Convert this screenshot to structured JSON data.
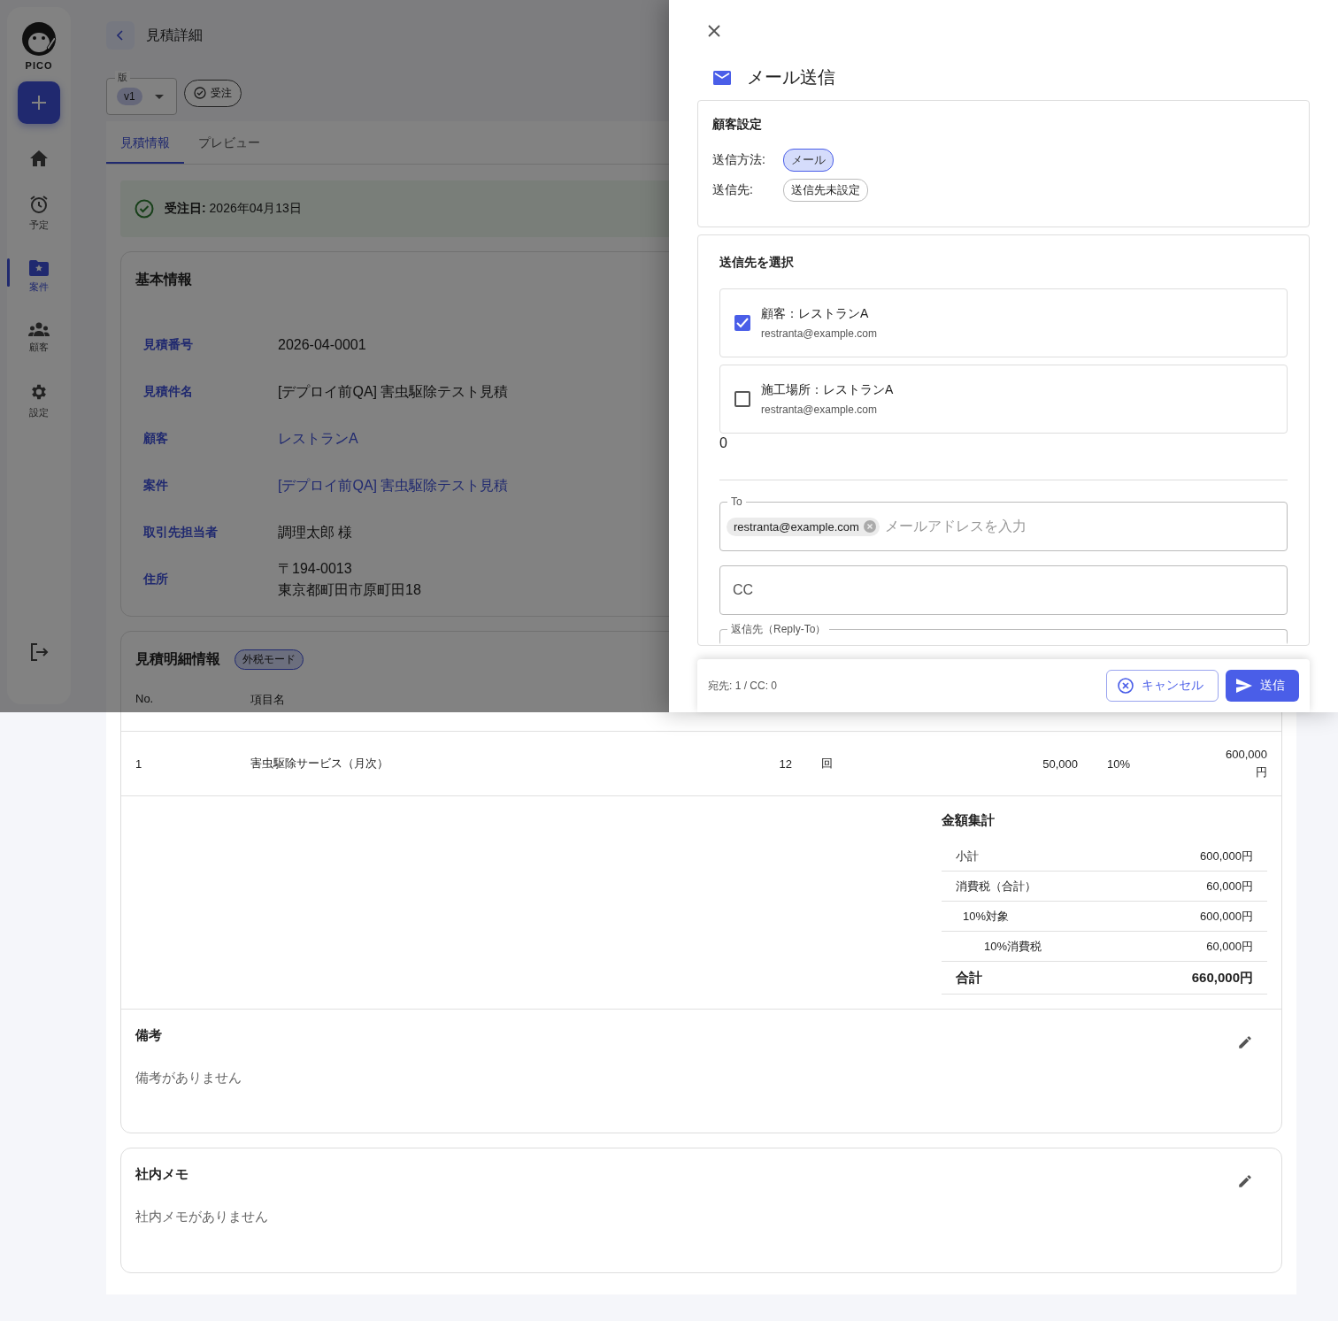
{
  "sidebar": {
    "logo_text": "PICO",
    "items": [
      {
        "kind": "add"
      },
      {
        "kind": "home",
        "selected": false
      },
      {
        "kind": "alarm",
        "label": "予定",
        "selected": false
      },
      {
        "kind": "folder",
        "label": "案件",
        "selected": true
      },
      {
        "kind": "people",
        "label": "顧客",
        "selected": false
      },
      {
        "kind": "gear",
        "label": "設定",
        "selected": false
      },
      {
        "kind": "logout",
        "selected": false
      }
    ]
  },
  "header": {
    "title": "見積詳細"
  },
  "version": {
    "label": "版",
    "value": "v1"
  },
  "status_chip": {
    "label": "受注"
  },
  "tabs": [
    {
      "label": "見積情報",
      "selected": true
    },
    {
      "label": "プレビュー",
      "selected": false
    }
  ],
  "alert": {
    "text": "**受注日:** 2026年04月13日"
  },
  "basic_info": {
    "title": "基本情報",
    "rows": [
      {
        "label": "見積番号",
        "kind": "text",
        "lines": [
          "2026-04-0001"
        ]
      },
      {
        "label": "見積件名",
        "kind": "text",
        "lines": [
          "[デプロイ前QA] 害虫駆除テスト見積"
        ]
      },
      {
        "label": "顧客",
        "kind": "link",
        "lines": [
          "レストランA"
        ]
      },
      {
        "label": "案件",
        "kind": "link",
        "lines": [
          "[デプロイ前QA] 害虫駆除テスト見積"
        ]
      },
      {
        "label": "取引先担当者",
        "kind": "text",
        "lines": [
          "調理太郎 様"
        ]
      },
      {
        "label": "住所",
        "kind": "text",
        "lines": [
          "〒194-0013",
          "東京都町田市原町田18"
        ]
      }
    ]
  },
  "details": {
    "title": "見積明細情報",
    "badge": "外税モード",
    "columns": [
      "No.",
      "項目名"
    ],
    "rows": [
      [
        "1",
        "害虫駆除サービス（月次）",
        "12",
        "回",
        "50,000",
        "10%",
        "600,000円"
      ]
    ],
    "summary": {
      "title": "金額集計",
      "rows": [
        {
          "kind": "subtotal",
          "label": "小計",
          "value": "600,000円"
        },
        {
          "kind": "tax",
          "label": "消費税（合計）",
          "value": "60,000円"
        },
        {
          "kind": "tax_base",
          "label": "10%対象",
          "value": "600,000円"
        },
        {
          "kind": "tax_detail",
          "label": "10%消費税",
          "value": "60,000円"
        },
        {
          "kind": "total",
          "label": "合計",
          "value": "660,000円"
        }
      ]
    }
  },
  "notes": [
    {
      "title": "備考",
      "text": "備考がありません"
    }
  ],
  "memo": {
    "title": "社内メモ",
    "text": "社内メモがありません"
  },
  "drawer": {
    "title": "メール送信",
    "customer_settings": {
      "title": "顧客設定",
      "rows": [
        {
          "label": "送信方法:",
          "chip": "メール",
          "selected": true
        },
        {
          "label": "送信先:",
          "chip": "送信先未設定",
          "selected": false
        }
      ]
    },
    "recipients": {
      "title": "送信先を選択",
      "options": [
        {
          "label": "顧客：レストランA",
          "email": "restranta@example.com",
          "checked": true
        },
        {
          "label": "施工場所：レストランA",
          "email": "restranta@example.com",
          "checked": false
        }
      ],
      "count": "0",
      "to": {
        "label": "To",
        "chips": [
          "restranta@example.com"
        ],
        "placeholder": "メールアドレスを入力"
      },
      "cc": {
        "placeholder": "CC"
      },
      "reply_to": {
        "label": "返信先（Reply-To）"
      }
    },
    "footer": {
      "summary": "宛先: 1 / CC: 0",
      "buttons": [
        {
          "kind": "cancel",
          "label": "キャンセル"
        },
        {
          "kind": "send",
          "label": "送信"
        }
      ]
    }
  }
}
